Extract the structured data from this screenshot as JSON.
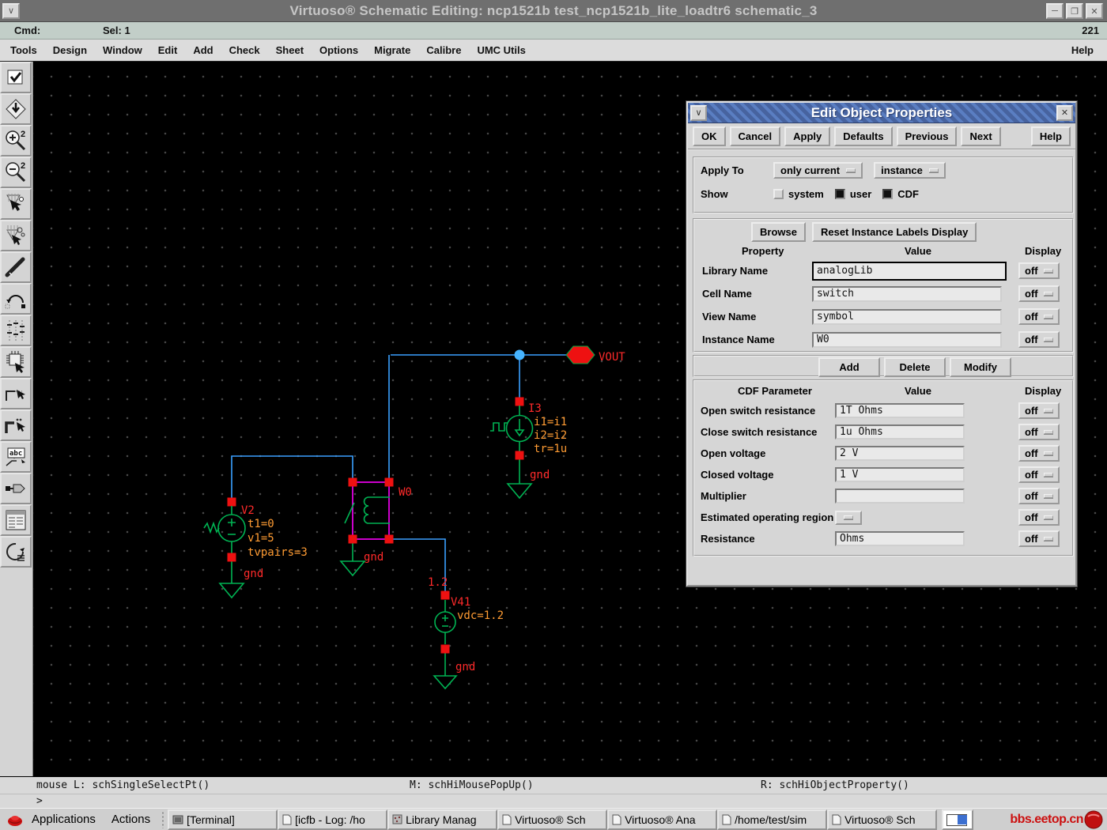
{
  "window": {
    "title": "Virtuoso® Schematic Editing: ncp1521b test_ncp1521b_lite_loadtr6 schematic_3"
  },
  "cmd_bar": {
    "label": "Cmd:",
    "selection": "Sel: 1",
    "counter": "221"
  },
  "menu_bar": {
    "items": [
      "Tools",
      "Design",
      "Window",
      "Edit",
      "Add",
      "Check",
      "Sheet",
      "Options",
      "Migrate",
      "Calibre",
      "UMC Utils"
    ],
    "help": "Help"
  },
  "toolbar": {
    "items": [
      "check-and-save",
      "save",
      "zoom-in-2x",
      "zoom-out-2x",
      "copy-instance",
      "stretch-instance",
      "wire-stroke",
      "hop-route",
      "ruler-grid",
      "instance",
      "narrow-wire",
      "wide-wire",
      "wire-name",
      "pin",
      "options-form",
      "repeat"
    ]
  },
  "schematic": {
    "vout_label": "VOUT",
    "v2": {
      "name": "V2",
      "params": [
        "t1=0",
        "v1=5",
        "tvpairs=3"
      ],
      "gnd": "gnd"
    },
    "i3": {
      "name": "I3",
      "params": [
        "i1=i1",
        "i2=i2",
        "tr=1u"
      ],
      "gnd": "gnd"
    },
    "w0": {
      "name": "W0",
      "gnd": "gnd"
    },
    "v41": {
      "name": "V41",
      "net": "1.2",
      "param": "vdc=1.2",
      "gnd": "gnd"
    }
  },
  "dialog": {
    "title": "Edit Object Properties",
    "buttons": [
      "OK",
      "Cancel",
      "Apply",
      "Defaults",
      "Previous",
      "Next"
    ],
    "help": "Help",
    "apply_to": {
      "label": "Apply To",
      "opt1": "only current",
      "opt2": "instance"
    },
    "show": {
      "label": "Show",
      "options": [
        {
          "label": "system",
          "checked": false
        },
        {
          "label": "user",
          "checked": true
        },
        {
          "label": "CDF",
          "checked": true
        }
      ]
    },
    "property_section": {
      "browse": "Browse",
      "reset": "Reset Instance Labels Display",
      "headers": {
        "property": "Property",
        "value": "Value",
        "display": "Display"
      },
      "rows": [
        {
          "label": "Library Name",
          "value": "analogLib",
          "display": "off"
        },
        {
          "label": "Cell Name",
          "value": "switch",
          "display": "off"
        },
        {
          "label": "View Name",
          "value": "symbol",
          "display": "off"
        },
        {
          "label": "Instance Name",
          "value": "W0",
          "display": "off"
        }
      ]
    },
    "cdf_buttons": [
      "Add",
      "Delete",
      "Modify"
    ],
    "cdf_section": {
      "headers": {
        "parameter": "CDF Parameter",
        "value": "Value",
        "display": "Display"
      },
      "rows": [
        {
          "label": "Open switch resistance",
          "value": "1T Ohms",
          "display": "off"
        },
        {
          "label": "Close switch resistance",
          "value": "1u Ohms",
          "display": "off"
        },
        {
          "label": "Open voltage",
          "value": "2 V",
          "display": "off"
        },
        {
          "label": "Closed voltage",
          "value": "1 V",
          "display": "off"
        },
        {
          "label": "Multiplier",
          "value": "",
          "display": "off"
        },
        {
          "label": "Estimated operating region",
          "value": "",
          "display": "off"
        },
        {
          "label": "Resistance",
          "value": "Ohms",
          "display": "off"
        }
      ]
    }
  },
  "status_bar": {
    "left": "mouse L: schSingleSelectPt()",
    "middle": "M: schHiMousePopUp()",
    "right": "R: schHiObjectProperty()",
    "prompt": ">"
  },
  "taskbar": {
    "applications": "Applications",
    "actions": "Actions",
    "windows": [
      "[Terminal]",
      "[icfb - Log: /ho",
      "Library Manag",
      "Virtuoso® Sch",
      "Virtuoso® Ana",
      "/home/test/sim",
      "Virtuoso® Sch"
    ],
    "watermark": "bbs.eetop.cn"
  },
  "colors": {
    "wire_blue": "#3aa0ff",
    "device_green": "#00b353",
    "label_red": "#ff2a2a",
    "param_orange": "#ff9c33",
    "selection_magenta": "#ff00ff",
    "dialog_title_blue": "#47639f"
  }
}
